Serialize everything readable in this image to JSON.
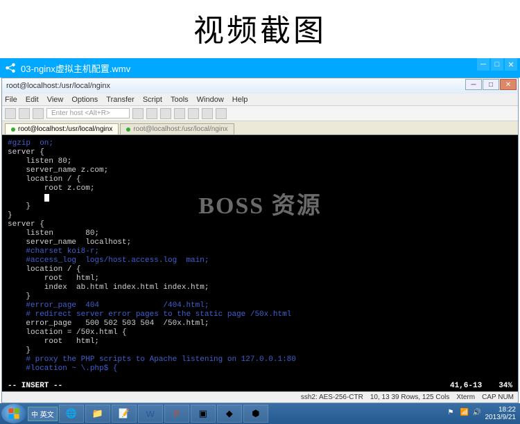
{
  "page_heading": "视频截图",
  "player": {
    "filename": "03-nginx虚拟主机配置.wmv"
  },
  "window": {
    "title": "root@localhost:/usr/local/nginx"
  },
  "menu": [
    "File",
    "Edit",
    "View",
    "Options",
    "Transfer",
    "Script",
    "Tools",
    "Window",
    "Help"
  ],
  "toolbar": {
    "host_placeholder": "Enter host <Alt+R>"
  },
  "tabs": [
    {
      "label": "root@localhost:/usr/local/nginx",
      "active": true
    },
    {
      "label": "root@localhost:/usr/local/nginx",
      "active": false
    }
  ],
  "code_lines": [
    {
      "t": "#gzip  on;",
      "c": "cmt"
    },
    {
      "t": "",
      "c": ""
    },
    {
      "t": "server {",
      "c": "kw"
    },
    {
      "t": "    listen 80;",
      "c": "kw"
    },
    {
      "t": "    server_name z.com;",
      "c": "kw"
    },
    {
      "t": "",
      "c": ""
    },
    {
      "t": "    location / {",
      "c": "kw"
    },
    {
      "t": "        root z.com;",
      "c": "kw"
    },
    {
      "t": "        ",
      "c": "kw",
      "cur": true
    },
    {
      "t": "    }",
      "c": "kw"
    },
    {
      "t": "}",
      "c": "kw"
    },
    {
      "t": "",
      "c": ""
    },
    {
      "t": "server {",
      "c": "kw"
    },
    {
      "t": "    listen       80;",
      "c": "kw"
    },
    {
      "t": "    server_name  localhost;",
      "c": "kw"
    },
    {
      "t": "",
      "c": ""
    },
    {
      "t": "    #charset koi8-r;",
      "c": "hi"
    },
    {
      "t": "    #access_log  logs/host.access.log  main;",
      "c": "hi"
    },
    {
      "t": "",
      "c": ""
    },
    {
      "t": "    location / {",
      "c": "kw"
    },
    {
      "t": "        root   html;",
      "c": "kw"
    },
    {
      "t": "        index  ab.html index.html index.htm;",
      "c": "kw"
    },
    {
      "t": "    }",
      "c": "kw"
    },
    {
      "t": "",
      "c": ""
    },
    {
      "t": "    #error_page  404              /404.html;",
      "c": "hi"
    },
    {
      "t": "    # redirect server error pages to the static page /50x.html",
      "c": "hi"
    },
    {
      "t": "",
      "c": ""
    },
    {
      "t": "    error_page   500 502 503 504  /50x.html;",
      "c": "kw"
    },
    {
      "t": "    location = /50x.html {",
      "c": "kw"
    },
    {
      "t": "        root   html;",
      "c": "kw"
    },
    {
      "t": "    }",
      "c": "kw"
    },
    {
      "t": "",
      "c": ""
    },
    {
      "t": "    # proxy the PHP scripts to Apache listening on 127.0.0.1:80",
      "c": "hi"
    },
    {
      "t": "    #location ~ \\.php$ {",
      "c": "hi"
    }
  ],
  "vim_status": {
    "mode": "-- INSERT --",
    "pos": "41,6-13",
    "pct": "34%"
  },
  "conn": {
    "cipher": "ssh2: AES-256-CTR",
    "size": "10, 13   39 Rows, 125 Cols",
    "term": "Xterm",
    "caps": "CAP  NUM"
  },
  "watermark": "BOSS 资源",
  "taskbar": {
    "lang": "中 英文",
    "time": "18:22",
    "date": "2013/9/21"
  }
}
